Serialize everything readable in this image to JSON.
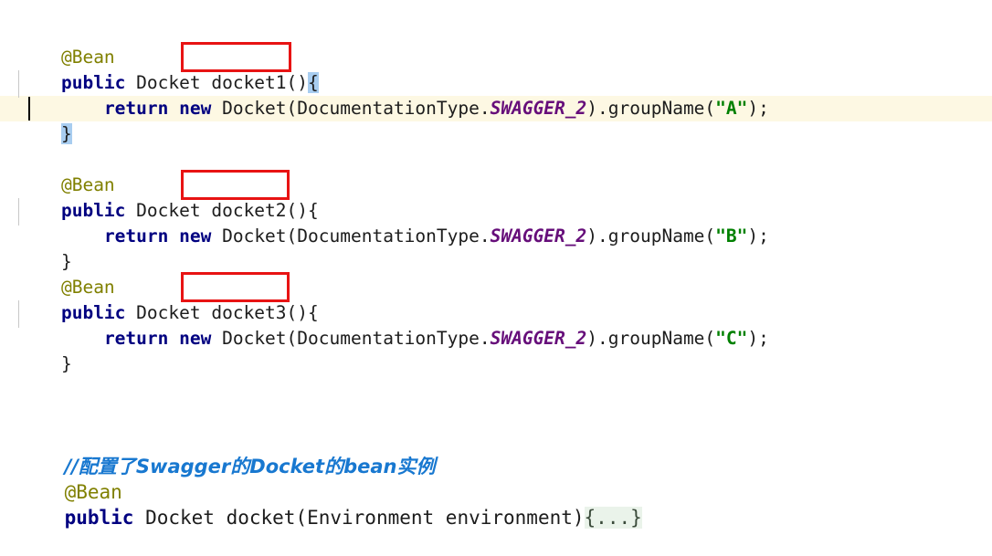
{
  "editor": {
    "background": "#ffffff",
    "current_line_color": "#fdf8e3",
    "bracket_match_color": "#a8cdf0",
    "annotation_box_color": "#e81313",
    "fold_background": "#eaf3ea",
    "colors": {
      "annotation": "#808000",
      "keyword": "#000080",
      "static_field": "#660e7a",
      "string": "#008000",
      "comment": "#1878d0",
      "plain_text": "#1c1c1c"
    }
  },
  "code": {
    "block1": {
      "annotation": "@Bean",
      "modifier": "public",
      "type": " Docket ",
      "method_name": "docket1()",
      "open_brace": "{",
      "body_indent": "    ",
      "kw_return": "return",
      "kw_new": " new",
      "body_expr": " Docket(DocumentationType.",
      "static_field": "SWAGGER_2",
      "body_call": ").groupName(",
      "group_name": "\"A\"",
      "body_end": ");",
      "close_brace": "}"
    },
    "block2": {
      "annotation": "@Bean",
      "modifier": "public",
      "type": " Docket ",
      "method_name": "docket2()",
      "open_brace": "{",
      "body_indent": "    ",
      "kw_return": "return",
      "kw_new": " new",
      "body_expr": " Docket(DocumentationType.",
      "static_field": "SWAGGER_2",
      "body_call": ").groupName(",
      "group_name": "\"B\"",
      "body_end": ");",
      "close_brace": "}"
    },
    "block3": {
      "annotation": "@Bean",
      "modifier": "public",
      "type": " Docket ",
      "method_name": "docket3()",
      "open_brace": "{",
      "body_indent": "    ",
      "kw_return": "return",
      "kw_new": " new",
      "body_expr": " Docket(DocumentationType.",
      "static_field": "SWAGGER_2",
      "body_call": ").groupName(",
      "group_name": "\"C\"",
      "body_end": ");",
      "close_brace": "}"
    },
    "block4": {
      "comment": "//配置了Swagger的Docket的bean实例",
      "annotation": "@Bean",
      "modifier": "public",
      "signature": " Docket docket(Environment environment)",
      "folded": "{...}"
    }
  }
}
